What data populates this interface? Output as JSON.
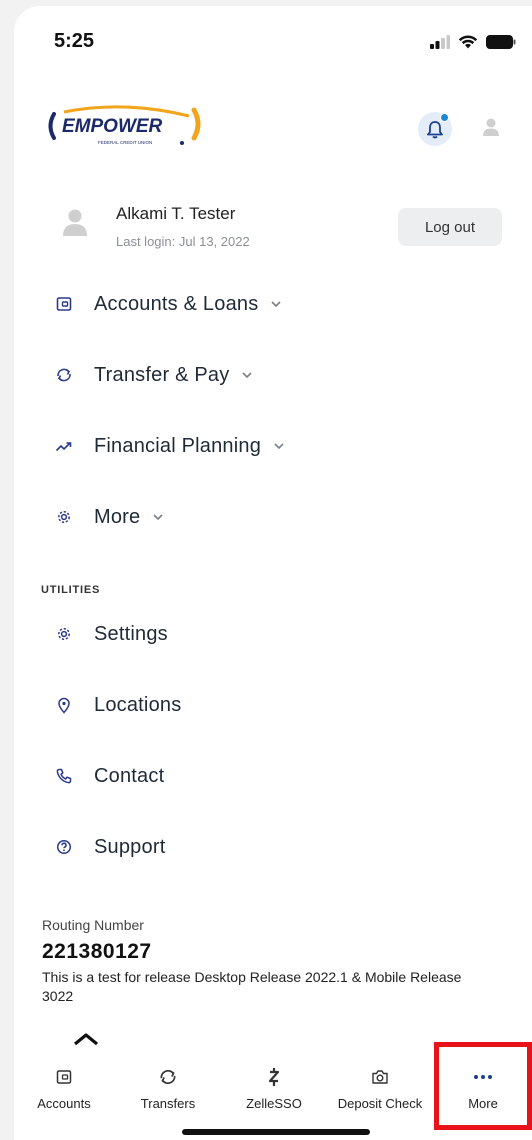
{
  "status_bar": {
    "time": "5:25"
  },
  "brand": {
    "logo_text": "EMPOWER",
    "logo_subtext": "FEDERAL CREDIT UNION",
    "accent": "#1c88d4",
    "logo_gold": "#f0a51c",
    "logo_navy": "#1b2a6b"
  },
  "profile": {
    "name": "Alkami T. Tester",
    "last_login": "Last login: Jul 13, 2022",
    "logout_label": "Log out"
  },
  "menu": [
    {
      "label": "Accounts & Loans",
      "icon": "wallet-icon",
      "expandable": true
    },
    {
      "label": "Transfer & Pay",
      "icon": "transfer-icon",
      "expandable": true
    },
    {
      "label": "Financial Planning",
      "icon": "trend-icon",
      "expandable": true
    },
    {
      "label": "More",
      "icon": "gear-icon",
      "expandable": true
    }
  ],
  "utilities": {
    "section_label": "UTILITIES",
    "items": [
      {
        "label": "Settings",
        "icon": "gear-icon"
      },
      {
        "label": "Locations",
        "icon": "location-pin-icon"
      },
      {
        "label": "Contact",
        "icon": "phone-icon"
      },
      {
        "label": "Support",
        "icon": "help-icon"
      }
    ]
  },
  "footer": {
    "routing_label": "Routing Number",
    "routing_number": "221380127",
    "release_text": "This is a test for release Desktop Release 2022.1 & Mobile Release 3022"
  },
  "tabbar": [
    {
      "label": "Accounts",
      "icon": "wallet-icon"
    },
    {
      "label": "Transfers",
      "icon": "transfer-icon"
    },
    {
      "label": "ZelleSSO",
      "icon": "zelle-icon"
    },
    {
      "label": "Deposit Check",
      "icon": "camera-icon"
    },
    {
      "label": "More",
      "icon": "ellipsis-icon",
      "highlighted": true
    }
  ],
  "highlight_color": "#e8121b"
}
